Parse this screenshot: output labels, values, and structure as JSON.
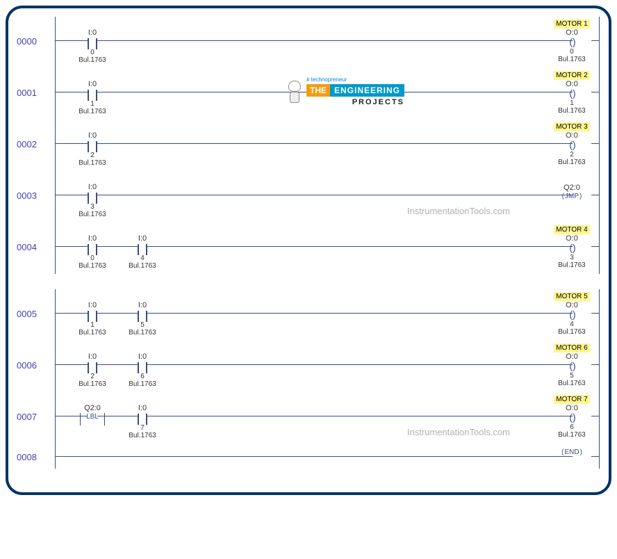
{
  "watermark1": "InstrumentationTools.com",
  "watermark2": "InstrumentationTools.com",
  "logo": {
    "tag": "# technopreneur",
    "the": "THE",
    "eng": "ENGINEERING",
    "proj": "PROJECTS"
  },
  "rungs": [
    {
      "num": "0000",
      "contacts": [
        {
          "addr": "I:0",
          "bit": "0",
          "desc": "Bul.1763",
          "type": "xic"
        }
      ],
      "coil": {
        "label": "MOTOR 1",
        "addr": "O:0",
        "bit": "0",
        "desc": "Bul.1763",
        "type": "ote"
      }
    },
    {
      "num": "0001",
      "contacts": [
        {
          "addr": "I:0",
          "bit": "1",
          "desc": "Bul.1763",
          "type": "xic"
        }
      ],
      "coil": {
        "label": "MOTOR 2",
        "addr": "O:0",
        "bit": "1",
        "desc": "Bul.1763",
        "type": "ote"
      },
      "hasLogo": true
    },
    {
      "num": "0002",
      "contacts": [
        {
          "addr": "I:0",
          "bit": "2",
          "desc": "Bul.1763",
          "type": "xic"
        }
      ],
      "coil": {
        "label": "MOTOR 3",
        "addr": "O:0",
        "bit": "2",
        "desc": "Bul.1763",
        "type": "ote"
      }
    },
    {
      "num": "0003",
      "contacts": [
        {
          "addr": "I:0",
          "bit": "3",
          "desc": "Bul.1763",
          "type": "xic"
        }
      ],
      "coil": {
        "label": "",
        "addr": "Q2:0",
        "bit": "",
        "desc": "",
        "type": "jmp",
        "text": "JMP"
      },
      "watermark": "watermark1"
    },
    {
      "num": "0004",
      "contacts": [
        {
          "addr": "I:0",
          "bit": "0",
          "desc": "Bul.1763",
          "type": "xic"
        },
        {
          "addr": "I:0",
          "bit": "4",
          "desc": "Bul.1763",
          "type": "xic"
        }
      ],
      "coil": {
        "label": "MOTOR 4",
        "addr": "O:0",
        "bit": "3",
        "desc": "Bul.1763",
        "type": "ote"
      }
    }
  ],
  "rungs2": [
    {
      "num": "0005",
      "contacts": [
        {
          "addr": "I:0",
          "bit": "1",
          "desc": "Bul.1763",
          "type": "xic"
        },
        {
          "addr": "I:0",
          "bit": "5",
          "desc": "Bul.1763",
          "type": "xic"
        }
      ],
      "coil": {
        "label": "MOTOR 5",
        "addr": "O:0",
        "bit": "4",
        "desc": "Bul.1763",
        "type": "ote"
      }
    },
    {
      "num": "0006",
      "contacts": [
        {
          "addr": "I:0",
          "bit": "2",
          "desc": "Bul.1763",
          "type": "xic"
        },
        {
          "addr": "I:0",
          "bit": "6",
          "desc": "Bul.1763",
          "type": "xic"
        }
      ],
      "coil": {
        "label": "MOTOR 6",
        "addr": "O:0",
        "bit": "5",
        "desc": "Bul.1763",
        "type": "ote"
      }
    },
    {
      "num": "0007",
      "contacts": [
        {
          "addr": "Q2:0",
          "bit": "",
          "desc": "",
          "type": "lbl",
          "text": "LBL"
        },
        {
          "addr": "I:0",
          "bit": "7",
          "desc": "Bul.1763",
          "type": "xic"
        }
      ],
      "coil": {
        "label": "MOTOR 7",
        "addr": "O:0",
        "bit": "6",
        "desc": "Bul.1763",
        "type": "ote"
      },
      "watermark": "watermark2"
    },
    {
      "num": "0008",
      "contacts": [],
      "coil": {
        "label": "",
        "addr": "",
        "bit": "",
        "desc": "",
        "type": "end",
        "text": "END"
      },
      "short": true
    }
  ]
}
